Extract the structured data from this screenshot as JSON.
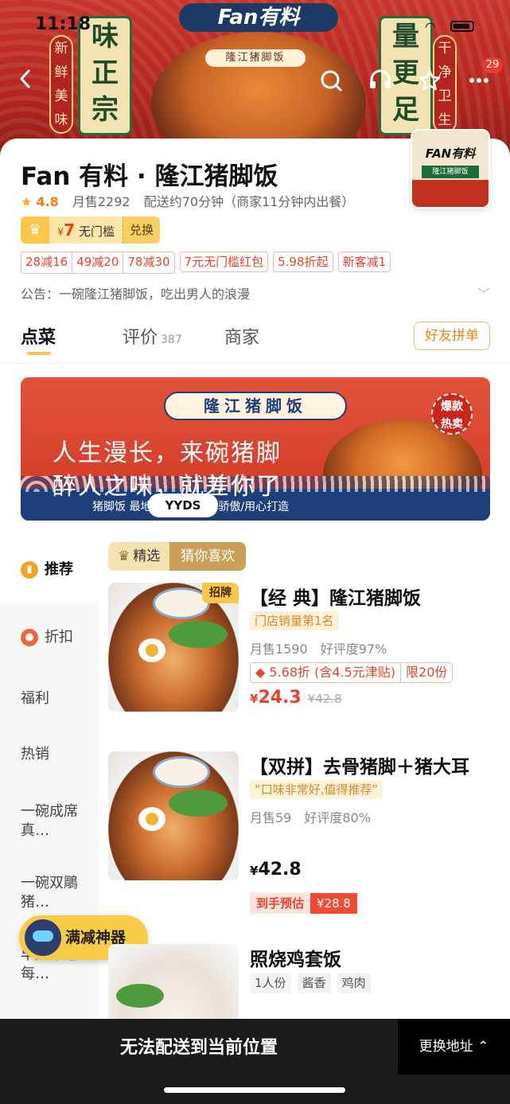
{
  "status_bar": {
    "time": "11:18"
  },
  "banner": {
    "brand": "Fan有料",
    "sub": "隆江猪脚饭",
    "plaque_left": [
      "味",
      "正",
      "宗"
    ],
    "plaque_right": [
      "量",
      "更",
      "足"
    ],
    "seal_left": [
      "新",
      "鲜",
      "美",
      "味"
    ],
    "seal_right": [
      "干",
      "净",
      "卫",
      "生"
    ]
  },
  "nav": {
    "back_icon": "chevron-left-icon",
    "search_icon": "search-icon",
    "service_icon": "headset-icon",
    "favorite_icon": "star-icon",
    "more_icon": "more-icon",
    "badge": "29"
  },
  "shop": {
    "title": "Fan 有料 · 隆江猪脚饭",
    "logo_text": "FAN有料",
    "logo_sub": "隆江猪脚饭",
    "rating": "4.8",
    "monthly_sales": "月售2292",
    "delivery": "配送约70分钟（商家11分钟内出餐）",
    "coupon": {
      "currency": "¥",
      "amount": "7",
      "label": "无门槛",
      "action": "兑换"
    },
    "promos": [
      "28减16",
      "49减20",
      "78减30",
      "7元无门槛红包",
      "5.98折起",
      "新客减1"
    ],
    "notice": "公告：一碗隆江猪脚饭，吃出男人的浪漫"
  },
  "tabs": {
    "order": "点菜",
    "review": "评价",
    "review_count": "387",
    "shop": "商家",
    "friend_order": "好友拼单"
  },
  "ad": {
    "title": "隆江猪脚饭",
    "line1": "人生漫长，来碗猪脚",
    "line2": "醉人之味，就差你了",
    "badge": "YYDS",
    "foot": "猪脚饭 最地道，猪脚饭的骄傲/用心打造",
    "hot": [
      "爆款",
      "热卖"
    ]
  },
  "categories": [
    {
      "label": "推荐",
      "icon": "bookmark-icon"
    },
    {
      "label": "折扣",
      "icon": "location-icon"
    },
    {
      "label": "福利"
    },
    {
      "label": "热销"
    },
    {
      "label": "一碗成席真…"
    },
    {
      "label": "一碗双鵰猪…"
    },
    {
      "label": "早点下送每…"
    }
  ],
  "floating": {
    "label": "满减神器"
  },
  "picks": {
    "selected": "精选",
    "guess": "猜你喜欢"
  },
  "products": [
    {
      "name": "【经 典】隆江猪脚饭",
      "tag": "招牌",
      "badge": "门店销量第1名",
      "monthly": "月售1590",
      "rating": "好评度97%",
      "discount": "5.68折 (含4.5元津贴)",
      "limit": "限20份",
      "currency": "¥",
      "price": "24.3",
      "old_price": "¥42.8"
    },
    {
      "name": "【双拼】去骨猪脚＋猪大耳",
      "badge": "“口味非常好,值得推荐”",
      "monthly": "月售59",
      "rating": "好评度80%",
      "currency": "¥",
      "price": "42.8",
      "est_label": "到手预估",
      "est_price": "¥28.8"
    },
    {
      "name": "照烧鸡套饭",
      "tags": [
        "1人份",
        "酱香",
        "鸡肉"
      ]
    }
  ],
  "bottom": {
    "message": "无法配送到当前位置",
    "change": "更换地址 ⌃"
  }
}
